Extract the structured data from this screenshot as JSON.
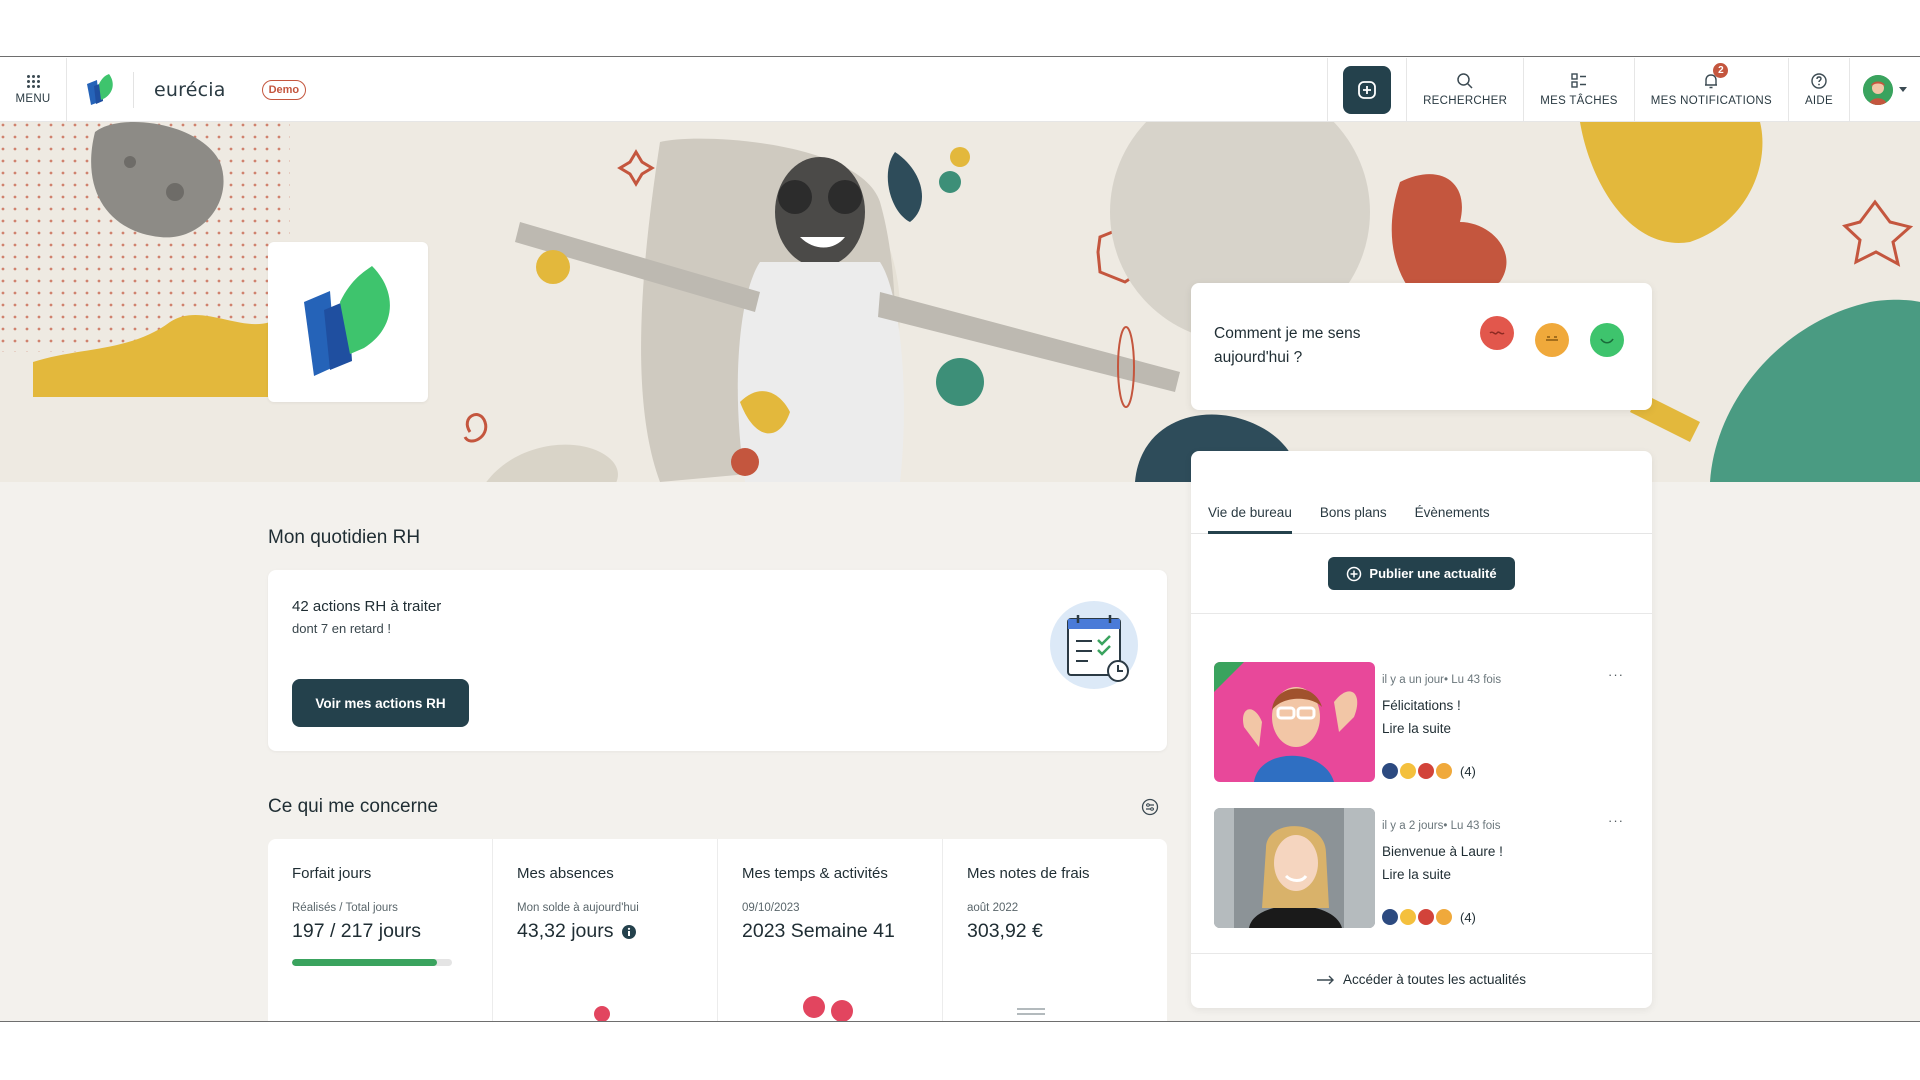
{
  "header": {
    "menu_label": "MENU",
    "brand_name": "eurécia",
    "demo_badge": "Demo",
    "search_label": "RECHERCHER",
    "tasks_label": "MES TÂCHES",
    "notifications_label": "MES NOTIFICATIONS",
    "notifications_count": "2",
    "help_label": "AIDE"
  },
  "mood": {
    "question": "Comment je me sens aujourd'hui ?",
    "faces": [
      {
        "name": "sad-face-icon",
        "color": "#e2574c"
      },
      {
        "name": "neutral-face-icon",
        "color": "#f0a93b"
      },
      {
        "name": "happy-face-icon",
        "color": "#3ec46d"
      }
    ]
  },
  "daily": {
    "title": "Mon quotidien RH",
    "actions_text": "42 actions RH à traiter",
    "late_text": "dont 7 en retard !",
    "button_label": "Voir mes actions RH"
  },
  "concern": {
    "title": "Ce qui me concerne",
    "tiles": [
      {
        "title": "Forfait jours",
        "sub": "Réalisés / Total jours",
        "value": "197 / 217 jours",
        "progress": 0.908
      },
      {
        "title": "Mes absences",
        "sub": "Mon solde à aujourd'hui",
        "value": "43,32 jours"
      },
      {
        "title": "Mes temps & activités",
        "sub": "09/10/2023",
        "value": "2023 Semaine 41"
      },
      {
        "title": "Mes notes de frais",
        "sub": "août 2022",
        "value": "303,92 €"
      }
    ]
  },
  "news": {
    "tabs": [
      "Vie de bureau",
      "Bons plans",
      "Évènements"
    ],
    "publish_label": "Publier une actualité",
    "posts": [
      {
        "meta": "il y a un jour• Lu 43 fois",
        "title": "Félicitations !",
        "link": "Lire la suite",
        "reactions": "(4)"
      },
      {
        "meta": "il y a 2 jours• Lu 43 fois",
        "title": "Bienvenue à Laure !",
        "link": "Lire la suite",
        "reactions": "(4)"
      }
    ],
    "all_label": "Accéder à toutes les actualités"
  },
  "colors": {
    "primary": "#24414c",
    "accent_red": "#c4563e",
    "green": "#3aa35e",
    "background": "#f3f1ed"
  }
}
